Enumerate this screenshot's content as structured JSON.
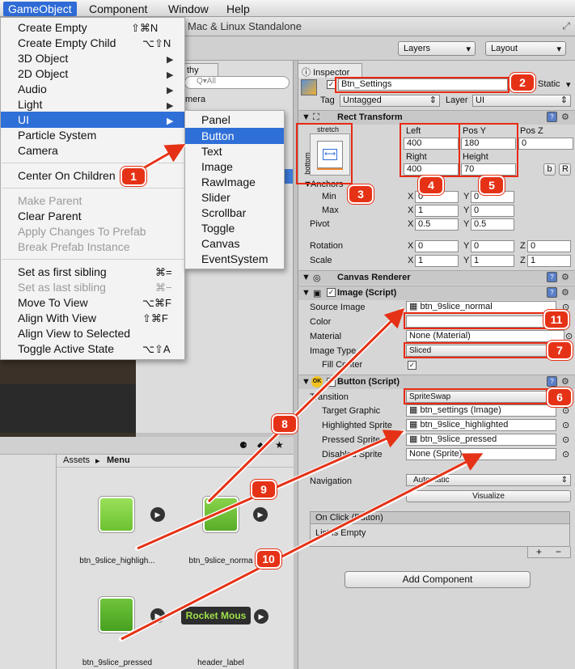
{
  "menubar": {
    "gameobject": "GameObject",
    "component": "Component",
    "window": "Window",
    "help": "Help"
  },
  "title": "Mac & Linux Standalone",
  "toolbar": {
    "layers": "Layers",
    "layout": "Layout"
  },
  "hierarchy": {
    "tab": "thy",
    "search": "Q▾All",
    "item": "mera"
  },
  "gameobject_menu": [
    {
      "label": "Create Empty",
      "shortcut": "⇧⌘N"
    },
    {
      "label": "Create Empty Child",
      "shortcut": "⌥⇧N"
    },
    {
      "label": "3D Object",
      "sub": "▶"
    },
    {
      "label": "2D Object",
      "sub": "▶"
    },
    {
      "label": "Audio",
      "sub": "▶"
    },
    {
      "label": "Light",
      "sub": "▶"
    },
    {
      "label": "UI",
      "sub": "▶"
    },
    {
      "label": "Particle System"
    },
    {
      "label": "Camera"
    },
    {
      "label": "Center On Children"
    },
    {
      "label": "Make Parent"
    },
    {
      "label": "Clear Parent"
    },
    {
      "label": "Apply Changes To Prefab"
    },
    {
      "label": "Break Prefab Instance"
    },
    {
      "label": "Set as first sibling",
      "shortcut": "⌘="
    },
    {
      "label": "Set as last sibling",
      "shortcut": "⌘−"
    },
    {
      "label": "Move To View",
      "shortcut": "⌥⌘F"
    },
    {
      "label": "Align With View",
      "shortcut": "⇧⌘F"
    },
    {
      "label": "Align View to Selected"
    },
    {
      "label": "Toggle Active State",
      "shortcut": "⌥⇧A"
    }
  ],
  "ui_submenu": [
    "Panel",
    "Button",
    "Text",
    "Image",
    "RawImage",
    "Slider",
    "Scrollbar",
    "Toggle",
    "Canvas",
    "EventSystem"
  ],
  "inspector": {
    "tab": "Inspector",
    "name": "Btn_Settings",
    "static": "Static",
    "tag_label": "Tag",
    "tag": "Untagged",
    "layer_label": "Layer",
    "layer": "UI",
    "rect_transform": "Rect Transform",
    "stretch": "stretch",
    "bottom": "bottom",
    "left_label": "Left",
    "left": "400",
    "right_label": "Right",
    "right": "400",
    "posy_label": "Pos Y",
    "posy": "180",
    "height_label": "Height",
    "height": "70",
    "posz_label": "Pos Z",
    "posz": "0",
    "b": "b",
    "r": "R",
    "anchors": "Anchors",
    "min": "Min",
    "max": "Max",
    "pivot": "Pivot",
    "rotation": "Rotation",
    "scale": "Scale",
    "x": "X",
    "y": "Y",
    "z": "Z",
    "min_x": "0",
    "min_y": "0",
    "max_x": "1",
    "max_y": "0",
    "pivot_x": "0.5",
    "pivot_y": "0.5",
    "rot_x": "0",
    "rot_y": "0",
    "rot_z": "0",
    "scale_x": "1",
    "scale_y": "1",
    "scale_z": "1",
    "canvas_renderer": "Canvas Renderer",
    "image_script": "Image (Script)",
    "source_image_label": "Source Image",
    "source_image": "btn_9slice_normal",
    "color_label": "Color",
    "material_label": "Material",
    "material": "None (Material)",
    "image_type_label": "Image Type",
    "image_type": "Sliced",
    "fill_center": "Fill Center",
    "button_script": "Button (Script)",
    "transition_label": "Transition",
    "transition": "SpriteSwap",
    "target_graphic_label": "Target Graphic",
    "target_graphic": "btn_settings (Image)",
    "highlighted_label": "Highlighted Sprite",
    "highlighted": "btn_9slice_highlighted",
    "pressed_label": "Pressed Sprite",
    "pressed": "btn_9slice_pressed",
    "disabled_label": "Disabled Sprite",
    "disabled": "None (Sprite)",
    "navigation_label": "Navigation",
    "navigation": "Automatic",
    "visualize": "Visualize",
    "onclick": "On Click (Button)",
    "list_empty": "List is Empty",
    "plus": "+",
    "minus": "−",
    "add_component": "Add Component"
  },
  "project": {
    "assets": "Assets",
    "sep": "▸",
    "menu": "Menu",
    "items": [
      "btn_9slice_highligh...",
      "btn_9slice_norma",
      "btn_9slice_pressed",
      "header_label"
    ],
    "header_text": "Rocket Mous"
  },
  "callouts": [
    "1",
    "2",
    "3",
    "4",
    "5",
    "6",
    "7",
    "8",
    "9",
    "10",
    "11"
  ],
  "colors": {
    "accent": "#2f6fd8",
    "callout": "#e53216",
    "green": "#7ccf3e"
  }
}
